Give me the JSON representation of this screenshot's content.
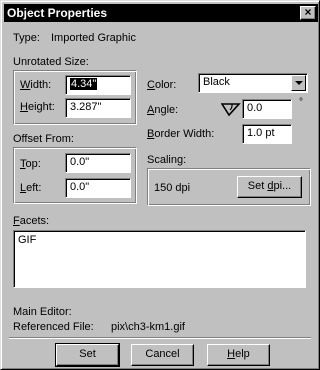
{
  "window": {
    "title": "Object Properties",
    "close_glyph": "×"
  },
  "type_row": {
    "label": "Type:",
    "value": "Imported Graphic"
  },
  "unrotated_size": {
    "label": "Unrotated Size:",
    "width": {
      "label": "Width:",
      "accel": "W",
      "rest": "idth:",
      "value": "4.34\""
    },
    "height": {
      "label": "Height:",
      "accel": "H",
      "rest": "eight:",
      "value": "3.287\""
    }
  },
  "offset_from": {
    "label": "Offset From:",
    "top": {
      "label": "Top:",
      "accel": "T",
      "rest": "op:",
      "value": "0.0\""
    },
    "left": {
      "label": "Left:",
      "accel": "L",
      "rest": "eft:",
      "value": "0.0\""
    }
  },
  "color": {
    "label": "Color:",
    "accel": "C",
    "rest": "olor:",
    "value": "Black"
  },
  "angle": {
    "label": "Angle:",
    "accel": "A",
    "rest": "ngle:",
    "value": "0.0",
    "unit": "°",
    "icon": "angle-icon"
  },
  "border_width": {
    "label": "Border Width:",
    "accel": "B",
    "rest": "order Width:",
    "value": "1.0 pt"
  },
  "scaling": {
    "label": "Scaling:",
    "value": "150 dpi",
    "button": {
      "label": "Set dpi...",
      "pre": "Set ",
      "accel": "d",
      "rest": "pi..."
    }
  },
  "facets": {
    "label": "Facets:",
    "accel": "F",
    "rest": "acets:",
    "value": "GIF"
  },
  "main_editor": {
    "label": "Main Editor:"
  },
  "referenced_file": {
    "label": "Referenced File:",
    "value": "pix\\ch3-km1.gif"
  },
  "buttons": {
    "set": {
      "label": "Set"
    },
    "cancel": {
      "label": "Cancel"
    },
    "help": {
      "label": "Help",
      "accel": "H",
      "rest": "elp"
    }
  }
}
